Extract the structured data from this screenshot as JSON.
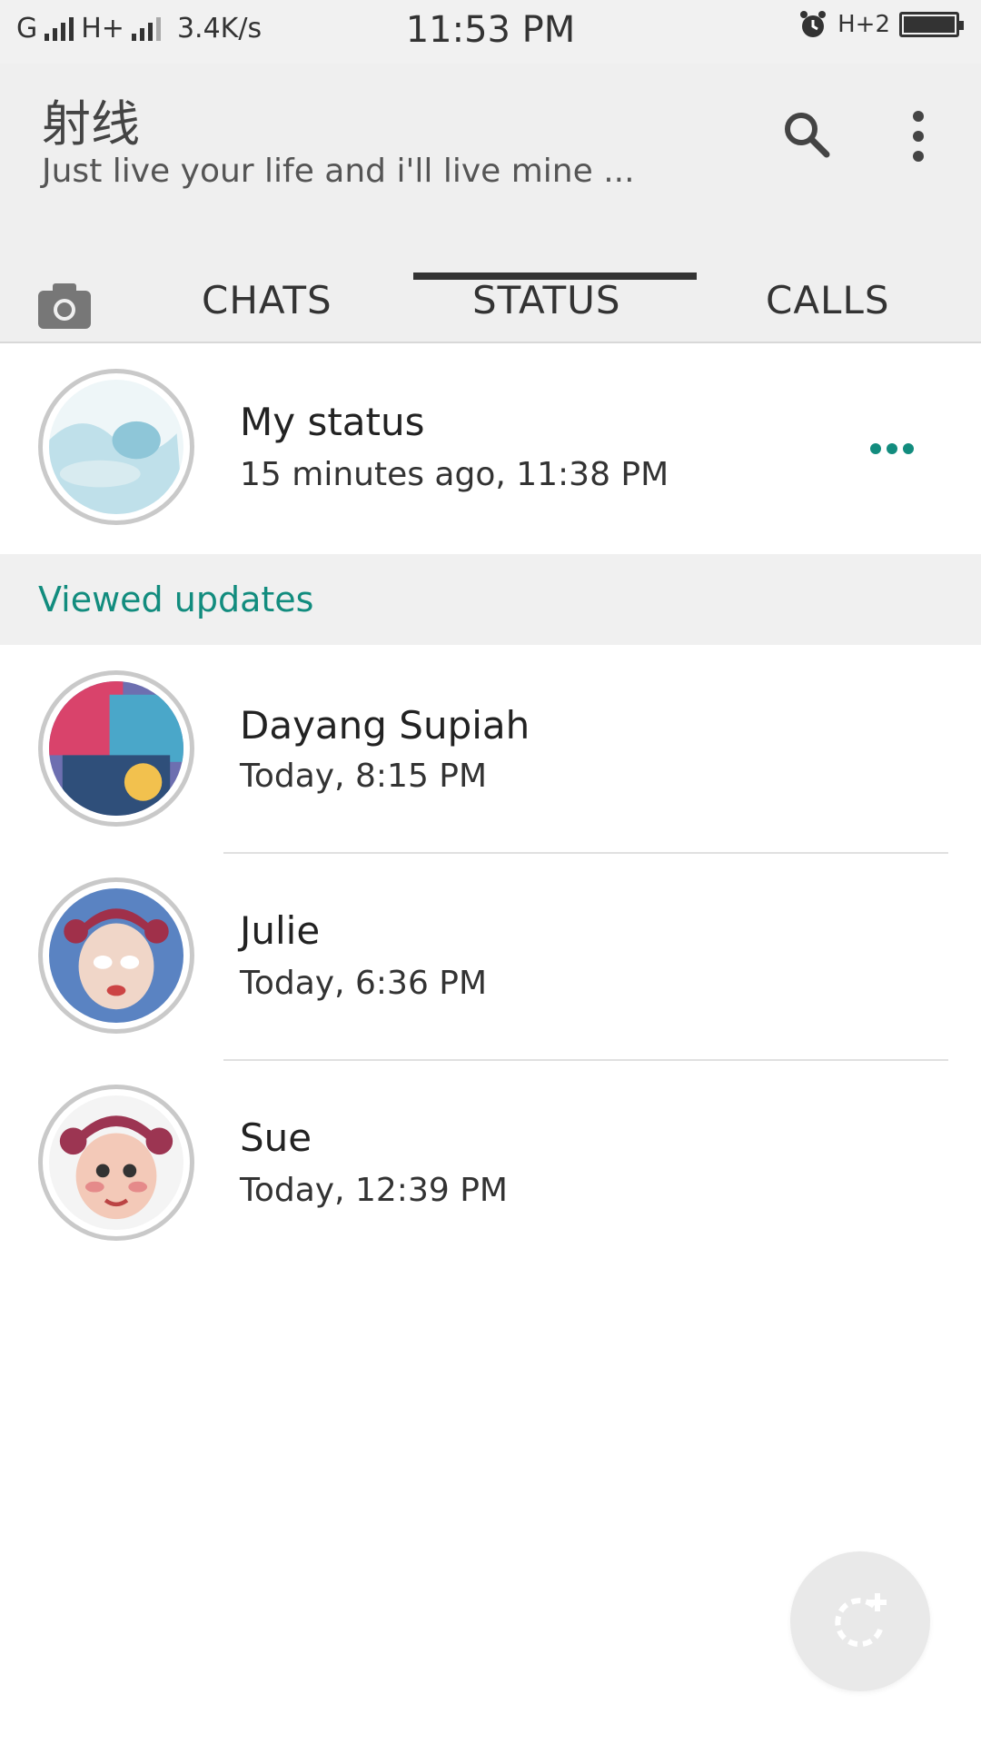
{
  "status_bar": {
    "carrier1": "G",
    "carrier2": "H+",
    "speed": "3.4K/s",
    "time": "11:53 PM",
    "network_right": "H+2"
  },
  "header": {
    "title": "射线",
    "subtitle": "Just live your life and i'll live mine ..."
  },
  "tabs": [
    {
      "label": "CHATS"
    },
    {
      "label": "STATUS"
    },
    {
      "label": "CALLS"
    }
  ],
  "active_tab": "STATUS",
  "my_status": {
    "name": "My status",
    "time": "15 minutes ago, 11:38 PM"
  },
  "section": {
    "label": "Viewed updates"
  },
  "contacts": [
    {
      "name": "Dayang Supiah",
      "time": "Today, 8:15 PM"
    },
    {
      "name": "Julie",
      "time": "Today, 6:36 PM"
    },
    {
      "name": "Sue",
      "time": "Today, 12:39 PM"
    }
  ],
  "colors": {
    "accent": "#128c7e",
    "header_bg": "#efefef",
    "tab_indicator": "#333333"
  },
  "icons": {
    "camera": "camera-icon",
    "search": "search-icon",
    "more": "more-vertical-icon",
    "status_menu": "more-horizontal-icon",
    "fab": "new-status-icon"
  }
}
